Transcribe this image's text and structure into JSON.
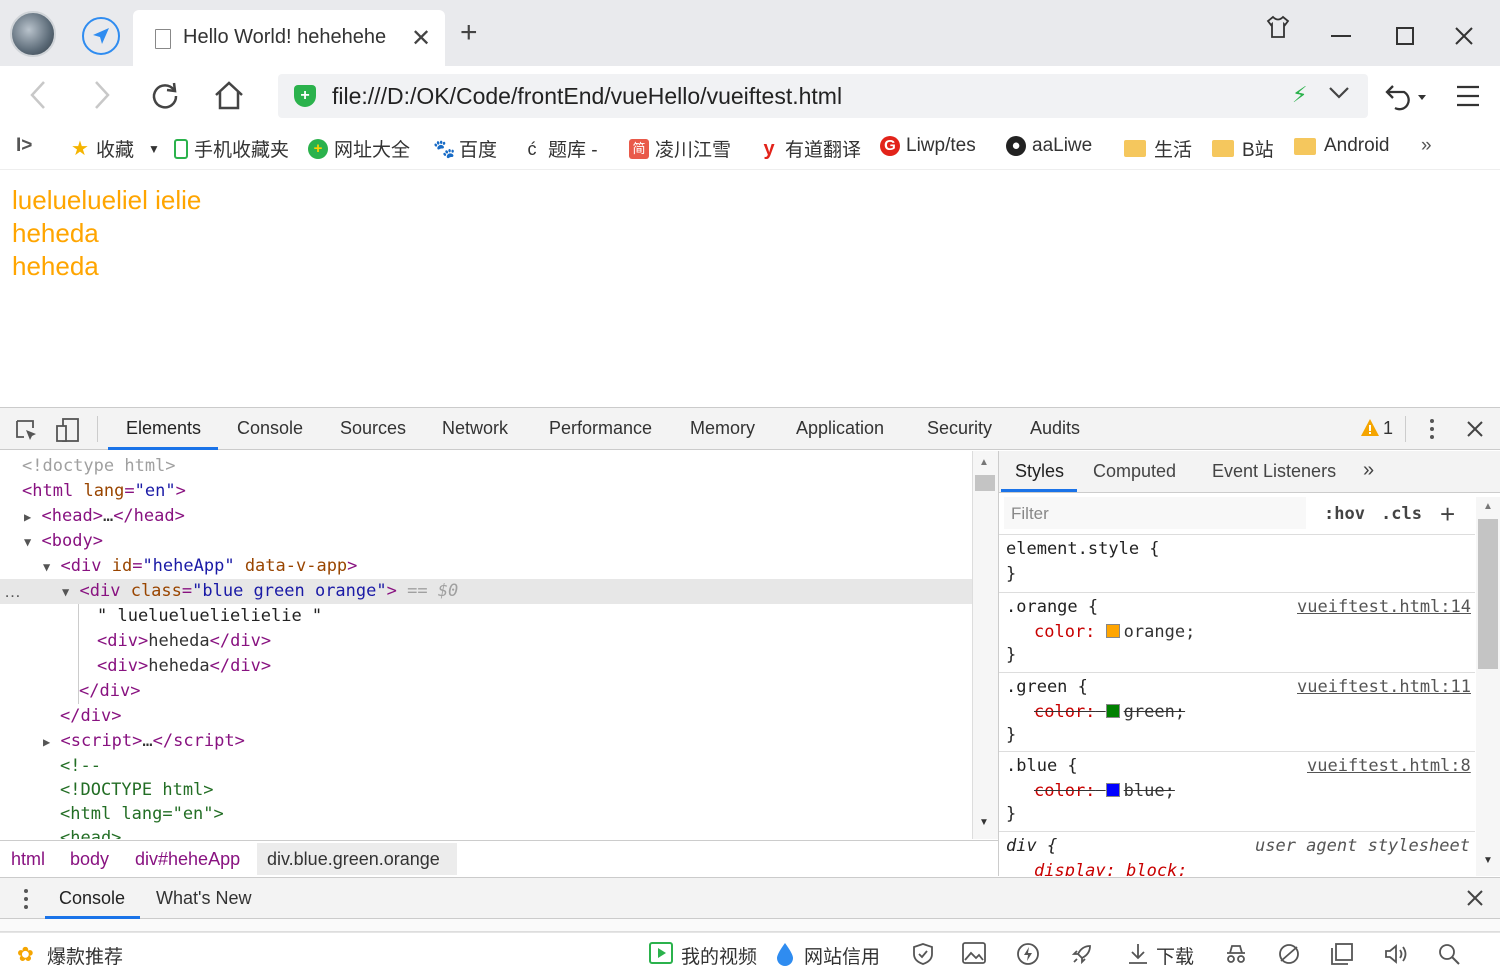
{
  "tab": {
    "title": "Hello World! hehehehe",
    "close": "✕",
    "new": "+"
  },
  "address": {
    "url": "file:///D:/OK/Code/frontEnd/vueHello/vueiftest.html"
  },
  "bookmarks": {
    "sidebar_toggle": "I>",
    "items": [
      "收藏",
      "手机收藏夹",
      "网址大全",
      "百度",
      "题库 -",
      "凌川江雪",
      "有道翻译",
      "Liwp/tes",
      "aaLiwe",
      "生活",
      "B站",
      "Android"
    ],
    "more": "»"
  },
  "page": {
    "lines": [
      "lueluelueliel ielie",
      "heheda",
      "heheda"
    ]
  },
  "devtools": {
    "tabs": [
      "Elements",
      "Console",
      "Sources",
      "Network",
      "Performance",
      "Memory",
      "Application",
      "Security",
      "Audits"
    ],
    "warning_count": "1",
    "dom": {
      "doctype": "<!doctype html>",
      "html_open": "html",
      "lang_attr": "lang",
      "lang_val": "\"en\"",
      "head": "head",
      "ellipsis": "…",
      "body": "body",
      "div": "div",
      "id_attr": "id",
      "id_val": "\"heheApp\"",
      "datav": "data-v-app",
      "class_attr": "class",
      "class_val": "\"blue green orange\"",
      "sel_marker": "== $0",
      "text_node": "\" luelueluelielielie \"",
      "child_text": "heheda",
      "script": "script",
      "comment_open": "<!--",
      "comment_doctype": "<!DOCTYPE html>",
      "comment_html": "<html lang=\"en\">",
      "comment_head": "<head>",
      "row_dots": "…"
    },
    "breadcrumbs": [
      "html",
      "body",
      "div#heheApp",
      "div.blue.green.orange"
    ],
    "styles_tabs": [
      "Styles",
      "Computed",
      "Event Listeners"
    ],
    "styles_more": "»",
    "filter_placeholder": "Filter",
    "hov": ":hov",
    "cls": ".cls",
    "add": "+",
    "rules": {
      "element_style": "element.style {",
      "close": "}",
      "orange_sel": ".orange {",
      "orange_src": "vueiftest.html:14",
      "orange_prop": "color:",
      "orange_val": "orange;",
      "green_sel": ".green {",
      "green_src": "vueiftest.html:11",
      "green_prop": "color:",
      "green_val": "green;",
      "blue_sel": ".blue {",
      "blue_src": "vueiftest.html:8",
      "blue_prop": "color:",
      "blue_val": "blue;",
      "div_sel": "div {",
      "div_src": "user agent stylesheet",
      "div_prop": "display: block;"
    },
    "swatches": {
      "orange": "#ffa500",
      "green": "#008000",
      "blue": "#0000ff"
    },
    "drawer_tabs": [
      "Console",
      "What's New"
    ]
  },
  "statusbar": {
    "left": "爆款推荐",
    "videos": "我的视频",
    "credit": "网站信用",
    "download": "下载"
  }
}
